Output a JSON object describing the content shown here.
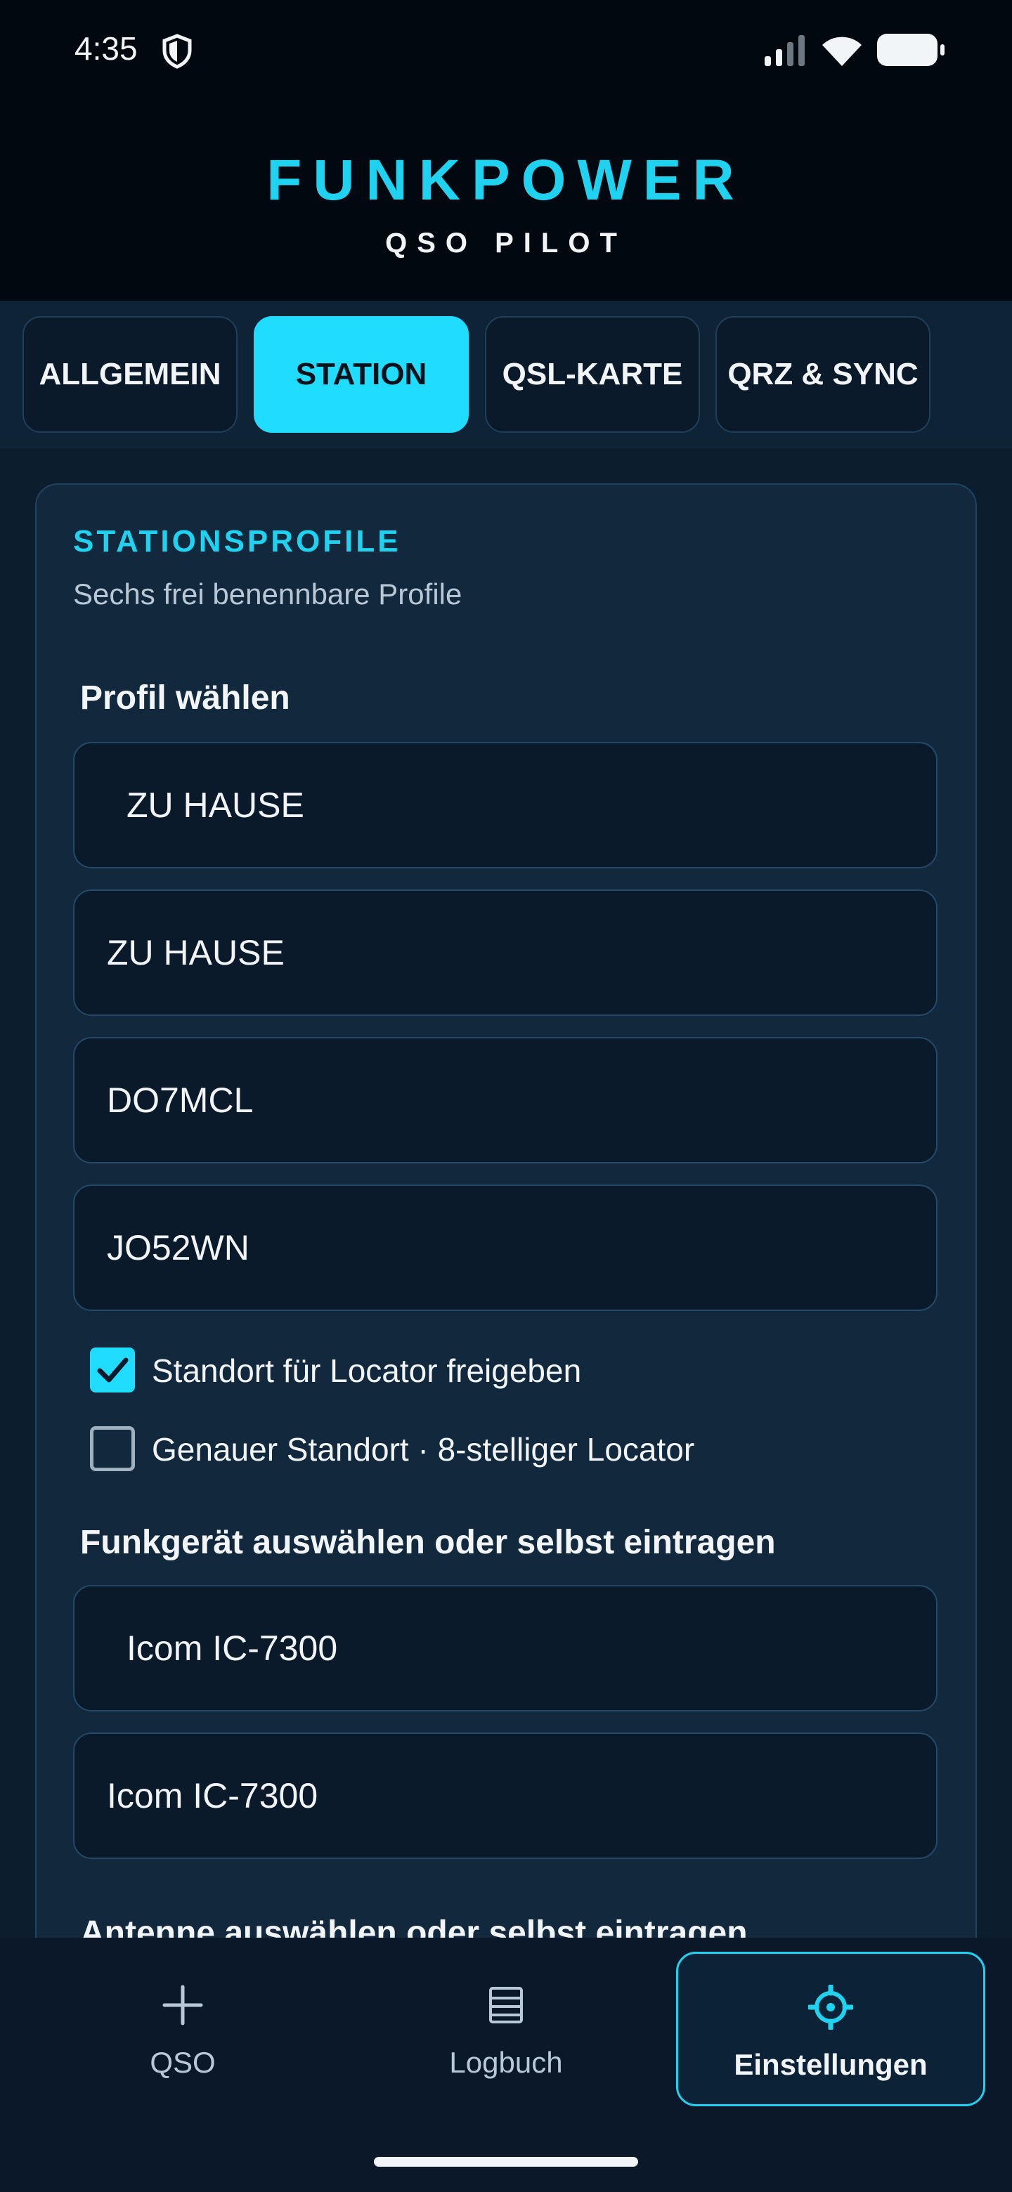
{
  "status_bar": {
    "time": "4:35"
  },
  "header": {
    "brand": "FUNKPOWER",
    "subtitle": "QSO PILOT"
  },
  "tabs": [
    {
      "label": "ALLGEMEIN",
      "active": false
    },
    {
      "label": "STATION",
      "active": true
    },
    {
      "label": "QSL-KARTE",
      "active": false
    },
    {
      "label": "QRZ & SYNC",
      "active": false
    }
  ],
  "section": {
    "title": "STATIONSPROFILE",
    "subtitle": "Sechs frei benennbare Profile"
  },
  "profile": {
    "label": "Profil wählen",
    "selected": "ZU HAUSE",
    "name_value": "ZU HAUSE",
    "callsign_value": "DO7MCL",
    "locator_value": "JO52WN"
  },
  "checkboxes": {
    "share_location": {
      "label": "Standort für Locator freigeben",
      "checked": true
    },
    "precise_location": {
      "label": "Genauer Standort · 8-stelliger Locator",
      "checked": false
    }
  },
  "radio": {
    "label": "Funkgerät auswählen oder selbst eintragen",
    "selected": "Icom IC-7300",
    "input_value": "Icom IC-7300"
  },
  "antenna": {
    "label": "Antenne auswählen oder selbst eintragen"
  },
  "bottom_nav": [
    {
      "label": "QSO",
      "icon": "plus-icon",
      "active": false
    },
    {
      "label": "Logbuch",
      "icon": "logbook-icon",
      "active": false
    },
    {
      "label": "Einstellungen",
      "icon": "gear-icon",
      "active": true
    }
  ],
  "colors": {
    "accent": "#20dcff",
    "background": "#040c14",
    "card": "#11283d"
  }
}
